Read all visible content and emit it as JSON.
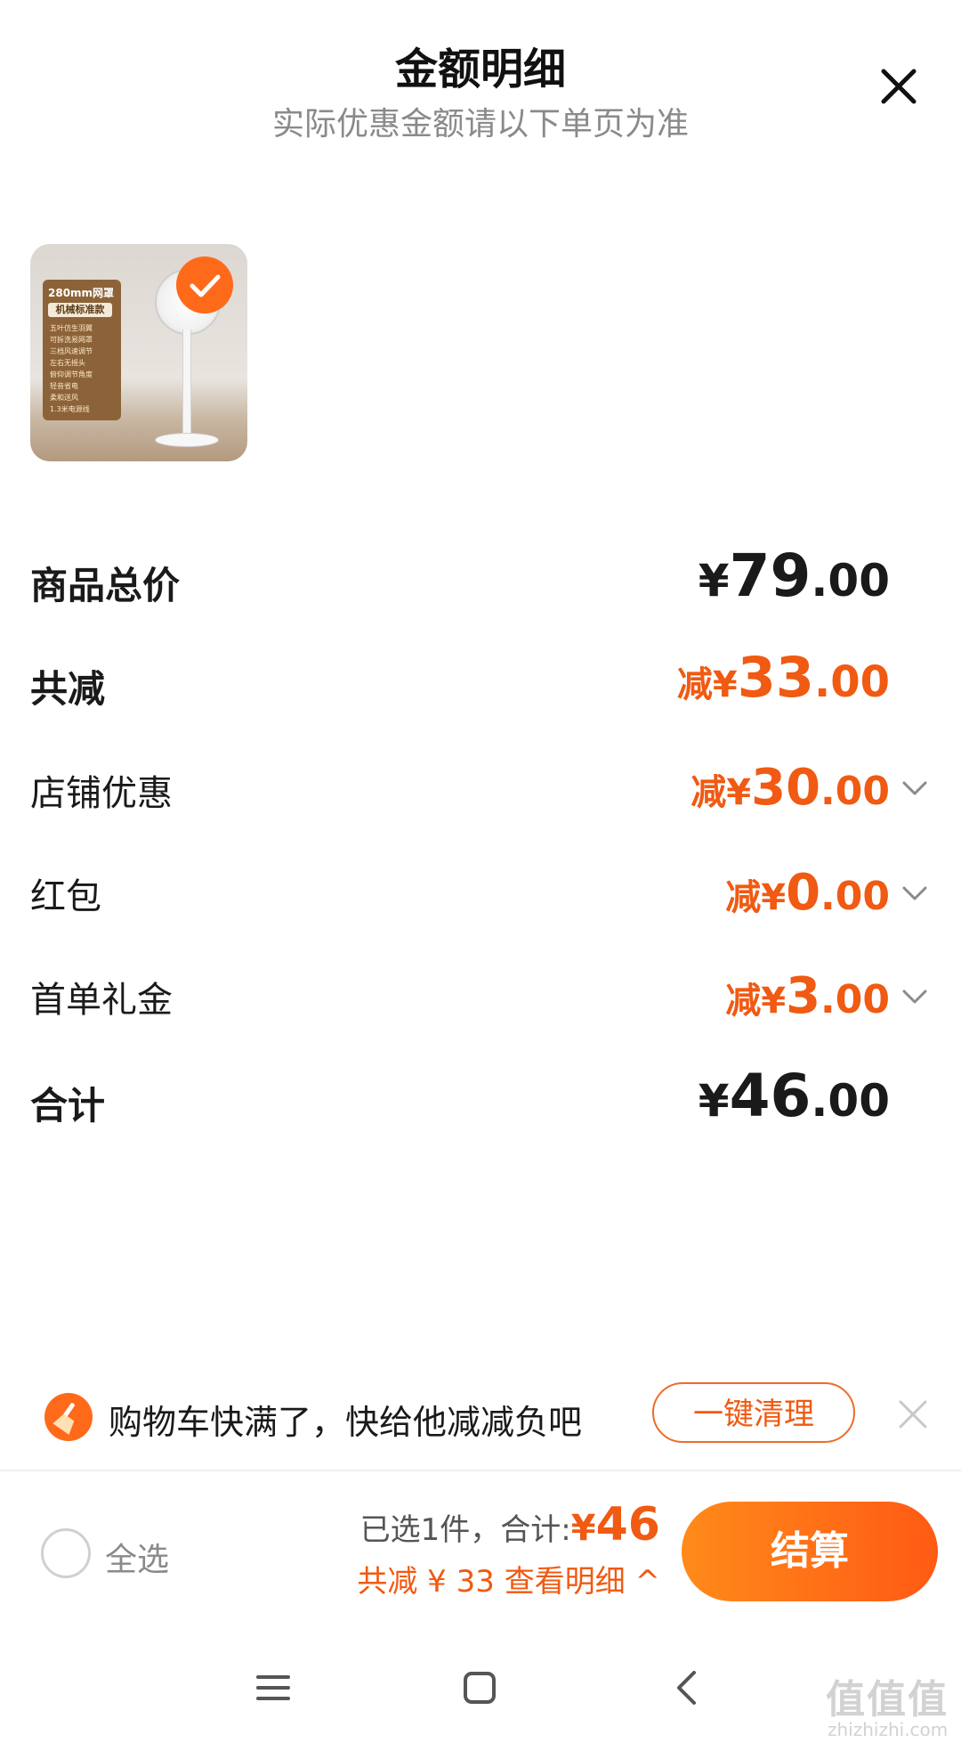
{
  "header": {
    "title": "金额明细",
    "subtitle": "实际优惠金额请以下单页为准"
  },
  "product": {
    "card_title": "280mm网罩",
    "card_badge": "机械标准款",
    "card_features": "五叶仿生羽翼\n可拆洗易网罩\n三档风速调节\n左右无摇头\n俯仰调节角度\n轻音省电\n柔和送风\n1.3米电源线",
    "selected": true
  },
  "rows": {
    "total_price": {
      "label": "商品总价",
      "symbol": "¥",
      "int": "79",
      "dec": ".00"
    },
    "total_discount": {
      "label": "共减",
      "prefix": "减¥",
      "int": "33",
      "dec": ".00"
    },
    "store_discount": {
      "label": "店铺优惠",
      "prefix": "减¥",
      "int": "30",
      "dec": ".00"
    },
    "red_packet": {
      "label": "红包",
      "prefix": "减¥",
      "int": "0",
      "dec": ".00"
    },
    "first_order_gift": {
      "label": "首单礼金",
      "prefix": "减¥",
      "int": "3",
      "dec": ".00"
    },
    "sum": {
      "label": "合计",
      "symbol": "¥",
      "int": "46",
      "dec": ".00"
    }
  },
  "banner": {
    "text": "购物车快满了，快给他减减负吧",
    "button": "一键清理"
  },
  "bottom_bar": {
    "select_all": "全选",
    "selected_count": "已选1件，",
    "total_label": "合计:",
    "total_symbol": "¥",
    "total_value": "46",
    "discount_detail": "共减 ¥ 33  查看明细 ^",
    "checkout": "结算"
  },
  "watermark": {
    "text": "值值值",
    "sub": "zhizhizhi.com"
  },
  "colors": {
    "accent": "#f05a12",
    "accent_gradient_start": "#ff8a1a",
    "text_primary": "#1a1a1a",
    "text_secondary": "#8a8a8a"
  }
}
